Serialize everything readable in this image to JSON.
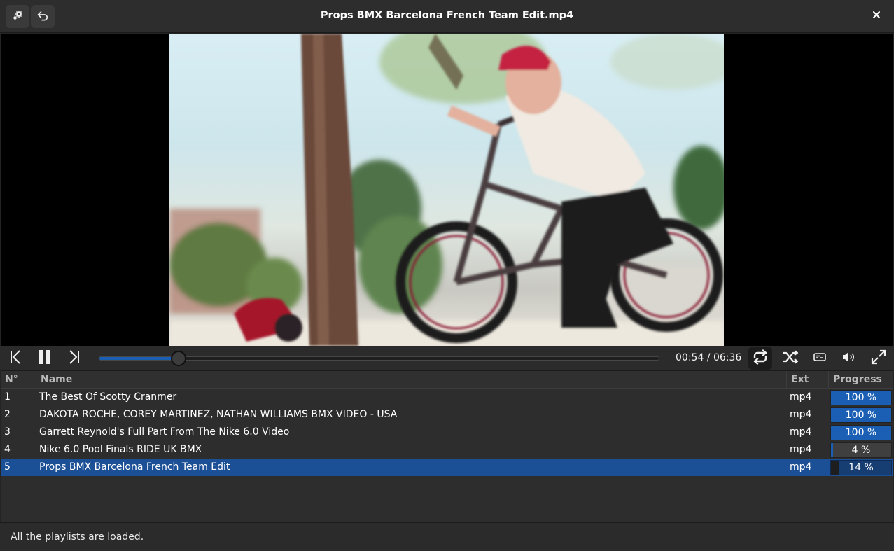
{
  "header": {
    "title": "Props BMX Barcelona French Team Edit.mp4",
    "settings_icon": "gear-icon",
    "back_icon": "undo-icon",
    "close_icon": "close-icon"
  },
  "player": {
    "time": "00:54 / 06:36",
    "progress_fraction": 0.1414,
    "controls": [
      "previous-icon",
      "pause-icon",
      "next-icon",
      "loop-icon",
      "shuffle-icon",
      "subtitles-icon",
      "volume-icon",
      "fullscreen-icon"
    ]
  },
  "playlist": {
    "columns": {
      "number": "N°",
      "name": "Name",
      "ext": "Ext",
      "progress": "Progress"
    },
    "rows": [
      {
        "number": "1",
        "name": "The Best Of Scotty Cranmer",
        "ext": "mp4",
        "progress": "100 %",
        "value": 1.0
      },
      {
        "number": "2",
        "name": "DAKOTA ROCHE, COREY MARTINEZ, NATHAN WILLIAMS BMX VIDEO - USA",
        "ext": "mp4",
        "progress": "100 %",
        "value": 1.0
      },
      {
        "number": "3",
        "name": "Garrett Reynold's Full Part From The Nike 6.0 Video",
        "ext": "mp4",
        "progress": "100 %",
        "value": 1.0
      },
      {
        "number": "4",
        "name": "Nike 6.0 Pool Finals RIDE UK BMX",
        "ext": "mp4",
        "progress": "4 %",
        "value": 0.04
      },
      {
        "number": "5",
        "name": "Props BMX Barcelona French Team Edit",
        "ext": "mp4",
        "progress": "14 %",
        "value": 0.14,
        "selected": true
      }
    ]
  },
  "status": {
    "text": "All the playlists are loaded."
  },
  "colors": {
    "accent": "#1a5fb4",
    "selection": "#1b4f96",
    "background": "#2d2d2d"
  }
}
